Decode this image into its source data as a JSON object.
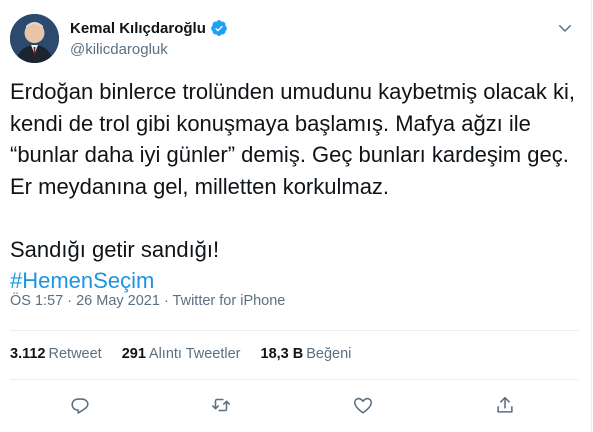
{
  "tweet": {
    "author": {
      "display_name": "Kemal Kılıçdaroğlu",
      "handle": "@kilicdarogluk",
      "verified": true
    },
    "text_paragraph1": "Erdoğan binlerce trolünden umudunu kaybetmiş olacak ki, kendi de trol gibi konuşmaya başlamış. Mafya ağzı ile “bunlar daha iyi günler” demiş. Geç bunları kardeşim geç. Er meydanına gel, milletten korkulmaz.",
    "text_paragraph2": "Sandığı getir sandığı!",
    "hashtag": "#HemenSeçim",
    "meta": "ÖS 1:57 · 26 May 2021 · Twitter for iPhone",
    "stats": {
      "retweets_count": "3.112",
      "retweets_label": "Retweet",
      "quotes_count": "291",
      "quotes_label": "Alıntı Tweetler",
      "likes_count": "18,3 B",
      "likes_label": "Beğeni"
    }
  },
  "icons": {
    "reply": "comment-icon",
    "retweet": "retweet-icon",
    "like": "heart-icon",
    "share": "share-icon",
    "more": "chevron-down-icon",
    "verified": "verified-badge-icon"
  },
  "colors": {
    "text": "#0f1419",
    "secondary": "#5b7083",
    "link": "#1b95e0",
    "verified": "#1da1f2",
    "divider": "#ebeef0"
  }
}
